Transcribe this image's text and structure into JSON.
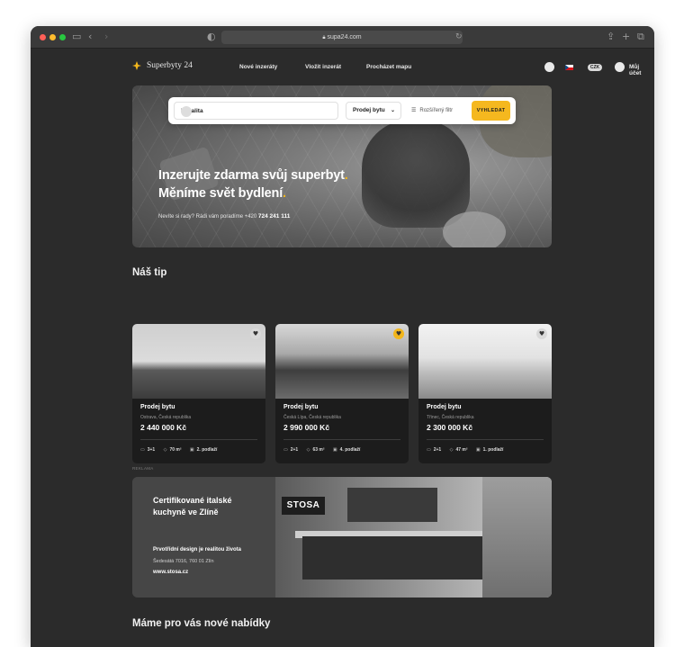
{
  "browser": {
    "url": "supa24.com",
    "traffic_light_colors": [
      "#ff5f57",
      "#febc2e",
      "#28c840"
    ]
  },
  "nav": {
    "logo_text": "Superbyty 24",
    "links": [
      "Nové inzeráty",
      "Vložit inzerát",
      "Procházet mapu"
    ],
    "currency": "CZK",
    "account": "Můj účet"
  },
  "hero": {
    "headline_line1": "Inzerujte zdarma svůj superbyt",
    "headline_line1_end": ".",
    "headline_line2": "Měníme svět bydlení",
    "headline_line2_end": ".",
    "help_text": "Nevíte si rady? Rádi vám poradíme +420 ",
    "help_phone": "724 241 111"
  },
  "search": {
    "location_placeholder": "Lokalita",
    "type_select": "Prodej bytu",
    "filter_label": "Rozšířený filtr",
    "submit_label": "VYHLEDAT"
  },
  "section_tip": {
    "title": "Náš tip"
  },
  "listings": [
    {
      "title": "Prodej bytu",
      "place": "Ostrava, Česká republika",
      "price": "2 440 000 Kč",
      "layout": "3+1",
      "area": "70 m²",
      "floor": "2. podlaží",
      "favorite_color": "#d9d9d9"
    },
    {
      "title": "Prodej bytu",
      "place": "Česká Lípa, Česká republika",
      "price": "2 990 000 Kč",
      "layout": "2+1",
      "area": "63 m²",
      "floor": "4. podlaží",
      "favorite_color": "#f2b61c"
    },
    {
      "title": "Prodej bytu",
      "place": "Třinec, Česká republika",
      "price": "2 300 000 Kč",
      "layout": "2+1",
      "area": "47 m²",
      "floor": "1. podlaží",
      "favorite_color": "#d9d9d9"
    }
  ],
  "ad": {
    "label": "REKLAMA",
    "brand": "STOSA",
    "title_line1": "Certifikované italské",
    "title_line2": "kuchyně ve Zlíně",
    "tagline": "Prvotřídní design je realitou života",
    "address": "Šedesátá 7016, 760 01 Zlín",
    "website": "www.stosa.cz"
  },
  "section_new": {
    "title": "Máme pro vás nové nabídky"
  },
  "colors": {
    "accent": "#f2b61c",
    "background": "#2b2b2b",
    "card": "#1c1c1c"
  }
}
